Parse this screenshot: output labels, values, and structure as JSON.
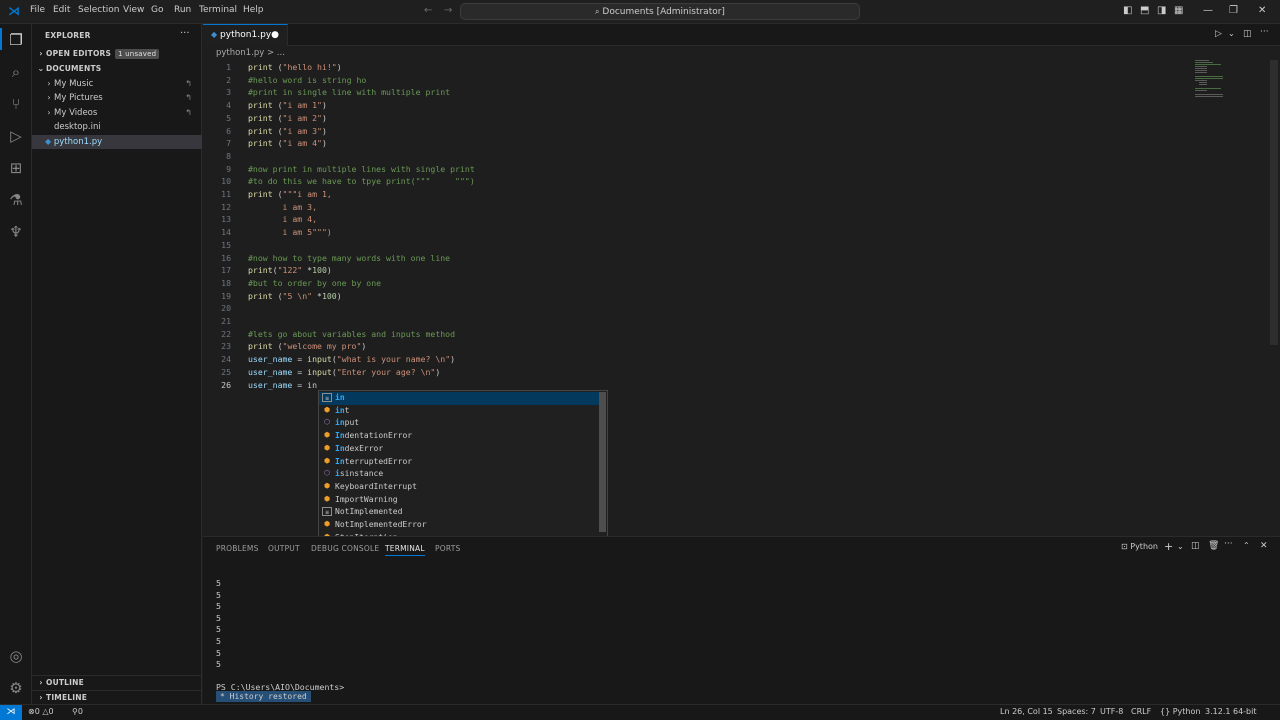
{
  "menu": [
    "File",
    "Edit",
    "Selection",
    "View",
    "Go",
    "Run",
    "Terminal",
    "Help"
  ],
  "command_center": "Documents [Administrator]",
  "sidebar": {
    "title": "EXPLORER",
    "open_editors": "OPEN EDITORS",
    "unsaved_badge": "1 unsaved",
    "folder": "DOCUMENTS",
    "items": [
      "My Music",
      "My Pictures",
      "My Videos",
      "desktop.ini",
      "python1.py"
    ],
    "outline": "OUTLINE",
    "timeline": "TIMELINE"
  },
  "editor": {
    "tab_label": "python1.py",
    "breadcrumb": "python1.py > ...",
    "lines": [
      "print (\"hello hi!\")",
      "#hello word is string ho",
      "#print in single line with multiple print",
      "print (\"i am 1\")",
      "print (\"i am 2\")",
      "print (\"i am 3\")",
      "print (\"i am 4\")",
      "",
      "#now print in multiple lines with single print",
      "#to do this we have to tpye print(\"\"\"     \"\"\")",
      "print (\"\"\"i am 1,",
      "       i am 3,",
      "       i am 4,",
      "       i am 5\"\"\")",
      "",
      "#now how to type many words with one line",
      "print(\"122\" *100)",
      "#but to order by one by one",
      "print (\"5 \\n\" *100)",
      "",
      "",
      "#lets go about variables and inputs method",
      "print (\"welcome my pro\")",
      "user_name = input(\"what is your name? \\n\")",
      "user_name = input(\"Enter your age? \\n\")",
      "user_name = in"
    ]
  },
  "suggestions": [
    {
      "label": "in",
      "kind": "keyword",
      "match": "in"
    },
    {
      "label": "int",
      "kind": "class",
      "match": "in"
    },
    {
      "label": "input",
      "kind": "function",
      "match": "in"
    },
    {
      "label": "IndentationError",
      "kind": "class",
      "match": "In"
    },
    {
      "label": "IndexError",
      "kind": "class",
      "match": "In"
    },
    {
      "label": "InterruptedError",
      "kind": "class",
      "match": "In"
    },
    {
      "label": "isinstance",
      "kind": "function",
      "match": "i"
    },
    {
      "label": "KeyboardInterrupt",
      "kind": "class",
      "match": ""
    },
    {
      "label": "ImportWarning",
      "kind": "class",
      "match": ""
    },
    {
      "label": "NotImplemented",
      "kind": "keyword",
      "match": ""
    },
    {
      "label": "NotImplementedError",
      "kind": "class",
      "match": ""
    },
    {
      "label": "StopIteration",
      "kind": "class",
      "match": ""
    }
  ],
  "panel": {
    "tabs": [
      "PROBLEMS",
      "OUTPUT",
      "DEBUG CONSOLE",
      "TERMINAL",
      "PORTS"
    ],
    "terminal_type": "Python",
    "output_lines": [
      "5",
      "5",
      "5",
      "5",
      "5",
      "5",
      "5",
      "5"
    ],
    "prompt": "PS C:\\Users\\AIO\\Documents>",
    "history_msg": "*  History restored"
  },
  "statusbar": {
    "errors": "0",
    "warnings": "0",
    "ports": "0",
    "position": "Ln 26, Col 15",
    "spaces": "Spaces: 7",
    "encoding": "UTF-8",
    "eol": "CRLF",
    "language": "Python",
    "interpreter": "3.12.1 64-bit"
  },
  "colors": {
    "accent": "#0078d4",
    "keyword": "#dcdcaa",
    "string": "#ce9178",
    "comment": "#6a9955"
  }
}
